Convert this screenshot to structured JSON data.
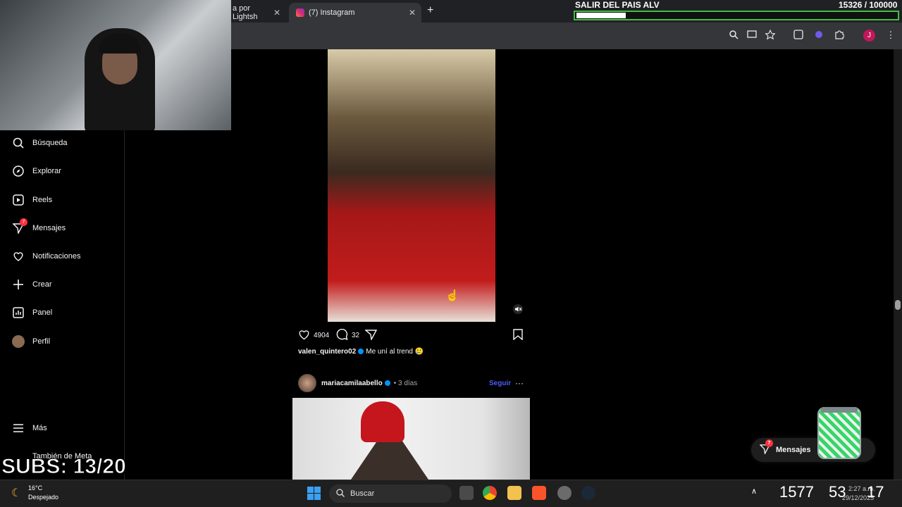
{
  "browser": {
    "tabs": [
      {
        "label": "a por Lightsh",
        "close": "✕"
      },
      {
        "label": "(7) Instagram",
        "close": "✕"
      }
    ],
    "new_tab": "+",
    "profile_initial": "J"
  },
  "overlay": {
    "goal_title": "SALIR DEL PAIS ALV",
    "goal_count": "15326 / 100000",
    "goal_progress": 0.15326,
    "subs": "SUBS: 13/20"
  },
  "sidebar": {
    "items": [
      {
        "label": "Búsqueda",
        "icon": "search-icon"
      },
      {
        "label": "Explorar",
        "icon": "compass-icon"
      },
      {
        "label": "Reels",
        "icon": "reels-icon"
      },
      {
        "label": "Mensajes",
        "icon": "messenger-icon",
        "badge": "7"
      },
      {
        "label": "Notificaciones",
        "icon": "heart-icon"
      },
      {
        "label": "Crear",
        "icon": "plus-icon"
      },
      {
        "label": "Panel",
        "icon": "dashboard-icon"
      },
      {
        "label": "Perfil",
        "icon": "avatar"
      }
    ],
    "more": "Más",
    "meta": "También de Meta"
  },
  "post1": {
    "likes": "4904",
    "comments": "32",
    "username": "valen_quintero02",
    "caption": "Me uní al trend 🥲"
  },
  "post2": {
    "username": "mariacamilaabello",
    "time": "• 3 días",
    "follow": "Seguir",
    "more": "···"
  },
  "messages_pill": {
    "label": "Mensajes",
    "badge": "7"
  },
  "taskbar": {
    "temp": "16°C",
    "weather": "Despejado",
    "search": "Buscar",
    "clock_big": [
      "1577",
      "53",
      "17"
    ],
    "time": "2:27 a.m.",
    "date": "29/12/2025"
  },
  "colors": {
    "accent": "#0095f6",
    "follow": "#4a5df9",
    "badge": "#ff3040",
    "goal_border": "#3fbf3f"
  }
}
